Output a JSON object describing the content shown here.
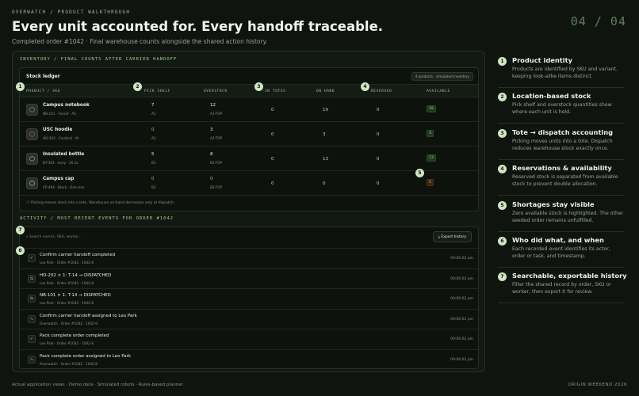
{
  "eyebrow": "OVERWATCH / PRODUCT WALKTHROUGH",
  "page_number": "04 / 04",
  "title": "Every unit accounted for. Every handoff traceable.",
  "subtitle": "Completed order #1042 · Final warehouse counts alongside the shared action history.",
  "inventory": {
    "section_label": "INVENTORY / FINAL COUNTS AFTER CARRIER HANDOFF",
    "ledger_title": "Stock ledger",
    "pill": "4 products · simulated inventory",
    "columns": [
      "PRODUCT / SKU",
      "PICK SHELF",
      "OVERSTOCK",
      "IN TOTES",
      "ON HAND",
      "RESERVED",
      "AVAILABLE"
    ],
    "rows": [
      {
        "name": "Campus notebook",
        "sku": "NB-101 · Forest · A5",
        "pick": "7",
        "pick_loc": "A1",
        "over": "12",
        "over_loc": "A1-TOP",
        "totes": "0",
        "onhand": "19",
        "reserved": "0",
        "available": "19",
        "icon": "box-icon",
        "icon_color": "#7fc47a"
      },
      {
        "name": "USC hoodie",
        "sku": "HD-202 · Cardinal · M",
        "pick": "0",
        "pick_loc": "A2",
        "over": "3",
        "over_loc": "A2-TOP",
        "totes": "0",
        "onhand": "3",
        "reserved": "0",
        "available": "3",
        "icon": "box-icon",
        "icon_color": "#e06a5a"
      },
      {
        "name": "Insulated bottle",
        "sku": "BT-303 · Ivory · 20 oz",
        "pick": "5",
        "pick_loc": "B1",
        "over": "8",
        "over_loc": "B1-TOP",
        "totes": "0",
        "onhand": "13",
        "reserved": "0",
        "available": "13",
        "icon": "box-icon",
        "icon_color": "#e8d8b0"
      },
      {
        "name": "Campus cap",
        "sku": "CP-404 · Black · One size",
        "pick": "0",
        "pick_loc": "B2",
        "over": "0",
        "over_loc": "B2-TOP",
        "totes": "0",
        "onhand": "0",
        "reserved": "0",
        "available": "0",
        "icon": "box-icon",
        "icon_color": "#e8ede4"
      }
    ],
    "footnote": "Picking moves stock into a tote. Warehouse on-hand decreases only at dispatch."
  },
  "activity": {
    "section_label": "ACTIVITY / MOST RECENT EVENTS FOR ORDER #1042",
    "search_placeholder": "Search events, SKU, worker...",
    "export_label": "Export history",
    "events": [
      {
        "title": "Confirm carrier handoff completed",
        "meta": "Leo Park · Order #1042 · 1042-8",
        "time": "09:06:02 pm",
        "icon": "check-circle-icon",
        "glyph": "✓"
      },
      {
        "title": "HD-202 × 1: T-14 → DISPATCHED",
        "meta": "Leo Park · Order #1042 · 1042-8",
        "time": "09:06:02 pm",
        "icon": "arrows-icon",
        "glyph": "⇆"
      },
      {
        "title": "NB-101 × 1: T-14 → DISPATCHED",
        "meta": "Leo Park · Order #1042 · 1042-8",
        "time": "09:06:02 pm",
        "icon": "arrows-icon",
        "glyph": "⇆"
      },
      {
        "title": "Confirm carrier handoff assigned to Leo Park",
        "meta": "Overwatch · Order #1042 · 1042-9",
        "time": "09:06:02 pm",
        "icon": "activity-icon",
        "glyph": "∿"
      },
      {
        "title": "Pack complete order completed",
        "meta": "Leo Park · Order #1042 · 1042-8",
        "time": "09:06:02 pm",
        "icon": "check-circle-icon",
        "glyph": "✓"
      },
      {
        "title": "Pack complete order assigned to Leo Park",
        "meta": "Overwatch · Order #1042 · 1042-8",
        "time": "09:06:02 pm",
        "icon": "activity-icon",
        "glyph": "∿"
      }
    ]
  },
  "badges": [
    "1",
    "2",
    "3",
    "4",
    "5",
    "7",
    "6"
  ],
  "features": [
    {
      "num": "1",
      "title": "Product identity",
      "desc": "Products are identified by SKU and variant, keeping look-alike items distinct."
    },
    {
      "num": "2",
      "title": "Location-based stock",
      "desc": "Pick shelf and overstock quantities show where each unit is held."
    },
    {
      "num": "3",
      "title": "Tote → dispatch accounting",
      "desc": "Picking moves units into a tote. Dispatch reduces warehouse stock exactly once."
    },
    {
      "num": "4",
      "title": "Reservations & availability",
      "desc": "Reserved stock is separated from available stock to prevent double allocation."
    },
    {
      "num": "5",
      "title": "Shortages stay visible",
      "desc": "Zero available stock is highlighted. The other seeded order remains unfulfilled."
    },
    {
      "num": "6",
      "title": "Who did what, and when",
      "desc": "Each recorded event identifies its actor, order or task, and timestamp."
    },
    {
      "num": "7",
      "title": "Searchable, exportable history",
      "desc": "Filter the shared record by order, SKU or worker, then export it for review."
    }
  ],
  "footer_left": "Actual application views · Demo data · Simulated robots · Rules-based planner",
  "footer_right": "ORIGIN WEEKEND 2026"
}
